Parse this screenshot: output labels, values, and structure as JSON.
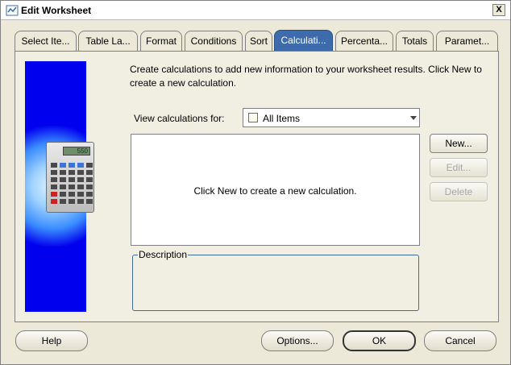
{
  "window": {
    "title": "Edit Worksheet",
    "close_label": "X"
  },
  "tabs": [
    {
      "label": "Select Ite...",
      "active": false
    },
    {
      "label": "Table La...",
      "active": false
    },
    {
      "label": "Format",
      "active": false
    },
    {
      "label": "Conditions",
      "active": false
    },
    {
      "label": "Sort",
      "active": false
    },
    {
      "label": "Calculati...",
      "active": true
    },
    {
      "label": "Percenta...",
      "active": false
    },
    {
      "label": "Totals",
      "active": false
    },
    {
      "label": "Paramet...",
      "active": false
    }
  ],
  "panel": {
    "intro_text": "Create calculations to add new information to your worksheet results.  Click New to create a new calculation.",
    "view_label": "View calculations for:",
    "view_value": "All Items",
    "empty_message": "Click New to create a new calculation.",
    "description_label": "Description",
    "calculator_display": "550"
  },
  "buttons": {
    "new": "New...",
    "edit": "Edit...",
    "delete": "Delete",
    "help": "Help",
    "options": "Options...",
    "ok": "OK",
    "cancel": "Cancel"
  },
  "colors": {
    "active_tab": "#3e6bab",
    "side_image_blue": "#0000ee",
    "dialog_bg": "#ece9d8"
  }
}
